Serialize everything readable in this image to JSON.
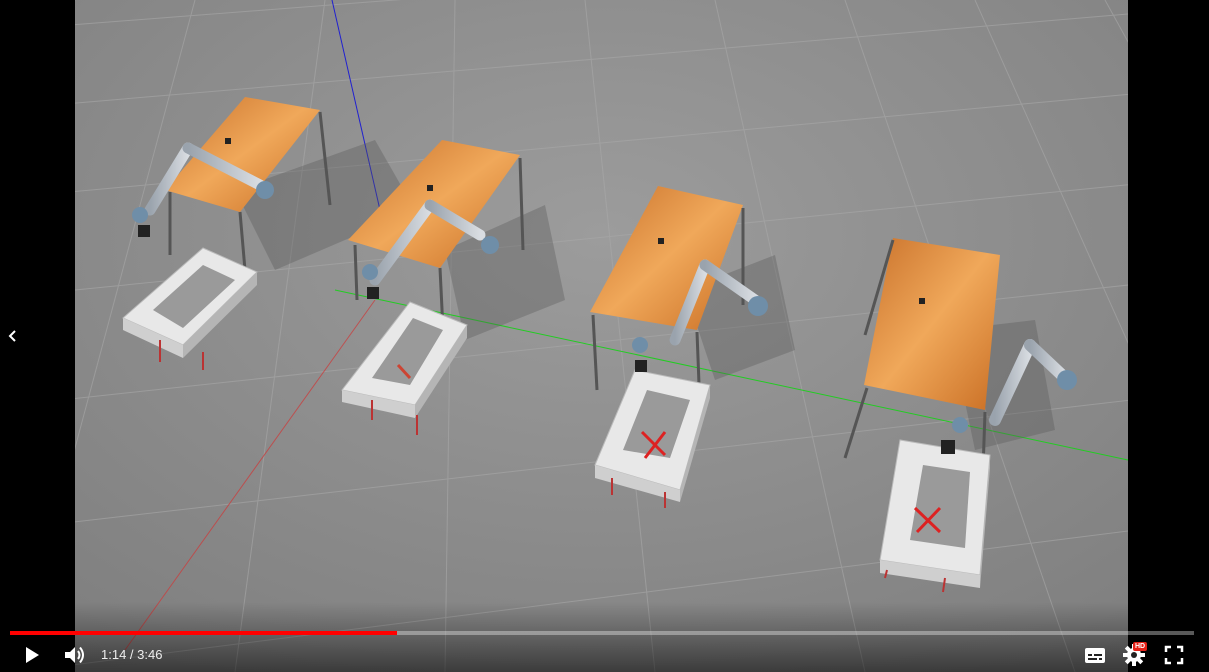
{
  "player": {
    "scene_description": "",
    "time": {
      "current": "1:14",
      "separator": " / ",
      "duration": "3:46"
    },
    "progress_fraction": 0.327,
    "hd_badge": "HD",
    "icons": {
      "prev": "chevron-left-icon",
      "play": "play-icon",
      "volume": "volume-icon",
      "subtitles": "subtitles-icon",
      "settings": "gear-icon",
      "fullscreen": "fullscreen-icon"
    },
    "colors": {
      "progress": "#ff0000",
      "ground": "#8f8f8f",
      "table_top": "#d8873c",
      "hd_badge": "#e62117"
    }
  }
}
